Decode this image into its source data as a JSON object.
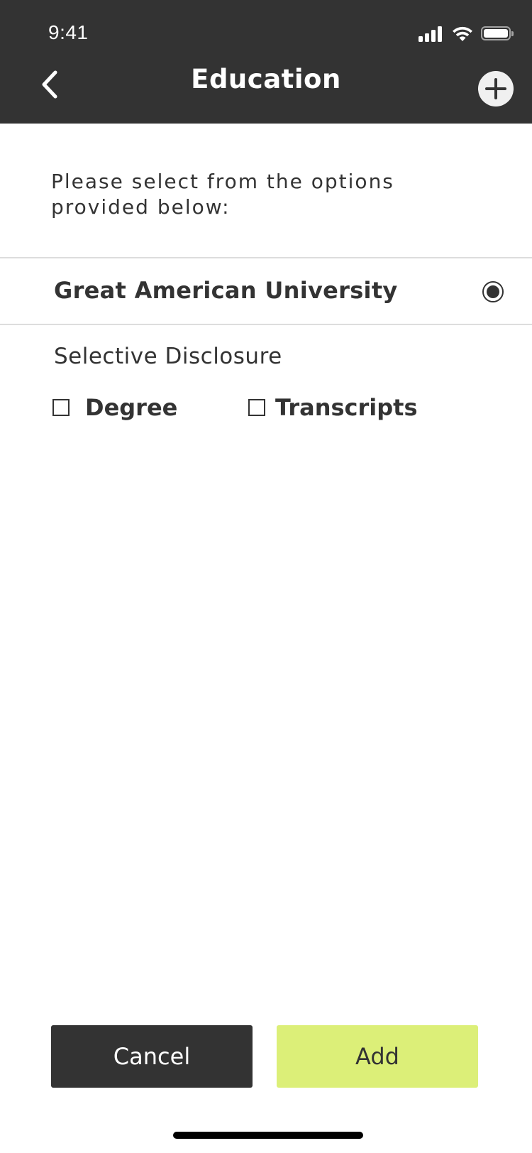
{
  "status_bar": {
    "time": "9:41"
  },
  "header": {
    "title": "Education",
    "back_icon": "chevron-left-icon",
    "add_icon": "plus-circle-icon"
  },
  "content": {
    "instructions": "Please select from the options provided below:",
    "institution": {
      "name": "Great American University",
      "selected": true
    },
    "section_label": "Selective Disclosure",
    "options": [
      {
        "label": "Degree",
        "checked": false
      },
      {
        "label": "Transcripts",
        "checked": false
      }
    ]
  },
  "actions": {
    "cancel_label": "Cancel",
    "add_label": "Add"
  },
  "colors": {
    "header_bg": "#333333",
    "accent": "#dcef78",
    "text": "#333333"
  }
}
